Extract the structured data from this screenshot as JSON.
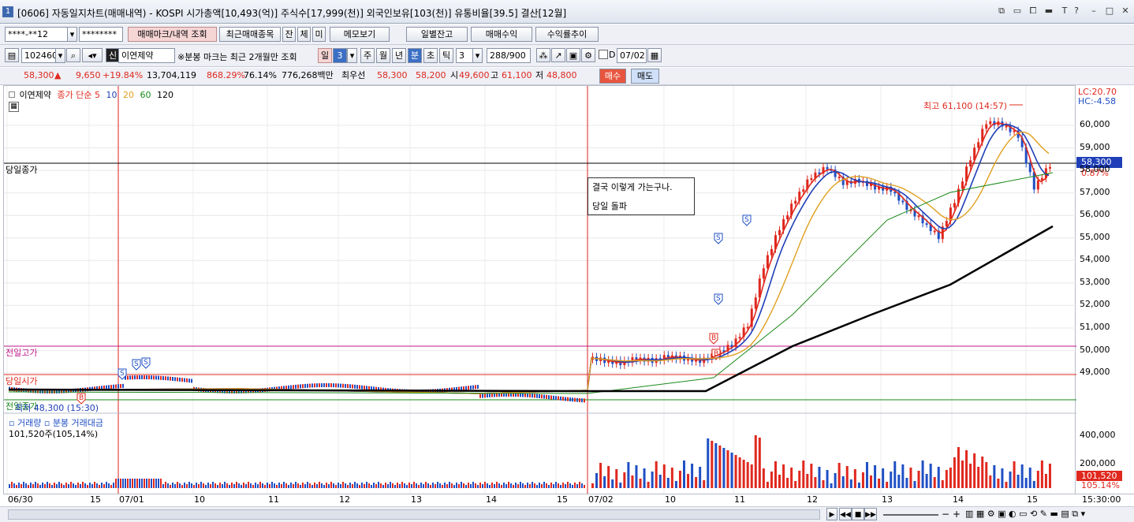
{
  "window": {
    "number": "1",
    "title": "[0606] 자동일지차트(매매내역) - KOSPI 시가총액[10,493(억)] 주식수[17,999(천)] 외국인보유[103(천)] 유통비율[39.5] 결산[12월]"
  },
  "toolbar1": {
    "account": "****-**12",
    "password": "********",
    "trade_mark_button": "매매마크/내역 조회",
    "recent_items_button": "최근매매종목",
    "tab_jan": "잔",
    "tab_che": "체",
    "tab_mi": "미",
    "memo_button": "메모보기",
    "daily_balance_button": "일별잔고",
    "trade_profit_button": "매매수익",
    "profit_trend_button": "수익률추이"
  },
  "toolbar2": {
    "code": "102460",
    "stock_name": "이연제약",
    "notice": "※분봉 마크는 최근 2개월만 조회",
    "period_il": "일",
    "period_num": "3",
    "period_ju": "주",
    "period_wol": "월",
    "period_nyeon": "년",
    "period_bun": "분",
    "period_cho": "초",
    "period_tick": "틱",
    "interval": "3",
    "count": "288/900",
    "date": "07/02"
  },
  "quote": {
    "price": "58,300",
    "change_arrow": "▲",
    "change": "9,650",
    "change_pct": "+19.84%",
    "volume": "13,704,119",
    "volume_pct": "868.29%",
    "turnover_pct": "76.14%",
    "amount": "776,268백만",
    "best_ask_label": "최우선",
    "best_ask": "58,300",
    "best_bid": "58,200",
    "open_label": "시",
    "open": "49,600",
    "high_label": "고",
    "high": "61,100",
    "low_label": "저",
    "low": "48,800",
    "buy_button": "매수",
    "sell_button": "매도"
  },
  "chart_legend": {
    "stock": "이연제약",
    "ma_label": "종가 단순",
    "ma5": "5",
    "ma10": "10",
    "ma20": "20",
    "ma60": "60",
    "ma120": "120"
  },
  "right_info": {
    "lc": "LC:20.70",
    "hc": "HC:-4.58"
  },
  "annotations": {
    "high_mark": "최고 61,100 (14:57)",
    "low_mark": "최저 48,300 (15:30)",
    "today_close": "당일종가",
    "prev_high": "전일고가",
    "today_open": "당일시가",
    "prev_close": "전일종가",
    "price_tag": "58,300",
    "price_tag_pct": "0.87%",
    "memo_line1": "결국 이렇게 가는구나.",
    "memo_line2": "당일 돌파"
  },
  "price_axis": [
    "60,000",
    "59,000",
    "58,000",
    "57,000",
    "56,000",
    "55,000",
    "54,000",
    "53,000",
    "52,000",
    "51,000",
    "50,000",
    "49,000"
  ],
  "volume_panel": {
    "title": "거래량",
    "sub": "분봉 거래대금",
    "value": "101,520주(105,14%)",
    "axis": [
      "400,000",
      "200,000"
    ],
    "tag": "101,520",
    "tag_pct": "105.14%"
  },
  "time_axis": [
    "06/30",
    "15",
    "07/01",
    "10",
    "11",
    "12",
    "13",
    "14",
    "15",
    "07/02",
    "10",
    "11",
    "12",
    "13",
    "14",
    "15"
  ],
  "time_end": "15:30:00",
  "colors": {
    "up": "#e0281e",
    "down": "#1f4fc4",
    "ma5": "#e0281e",
    "ma10": "#1f3fb8",
    "ma20": "#e0a020",
    "ma60": "#1a8a1a",
    "ma120": "#000000"
  },
  "chart_data": {
    "type": "candlestick",
    "title": "",
    "ylim": [
      48000,
      60800
    ],
    "series_close_0702": [
      49600,
      49500,
      49700,
      49600,
      49800,
      49700,
      49600,
      49900,
      50300,
      51200,
      53800,
      55500,
      56800,
      57800,
      58200,
      57500,
      57600,
      57300,
      57200,
      56400,
      55800,
      55100,
      56700,
      58600,
      60200,
      60100,
      59600,
      57300,
      58300
    ]
  }
}
